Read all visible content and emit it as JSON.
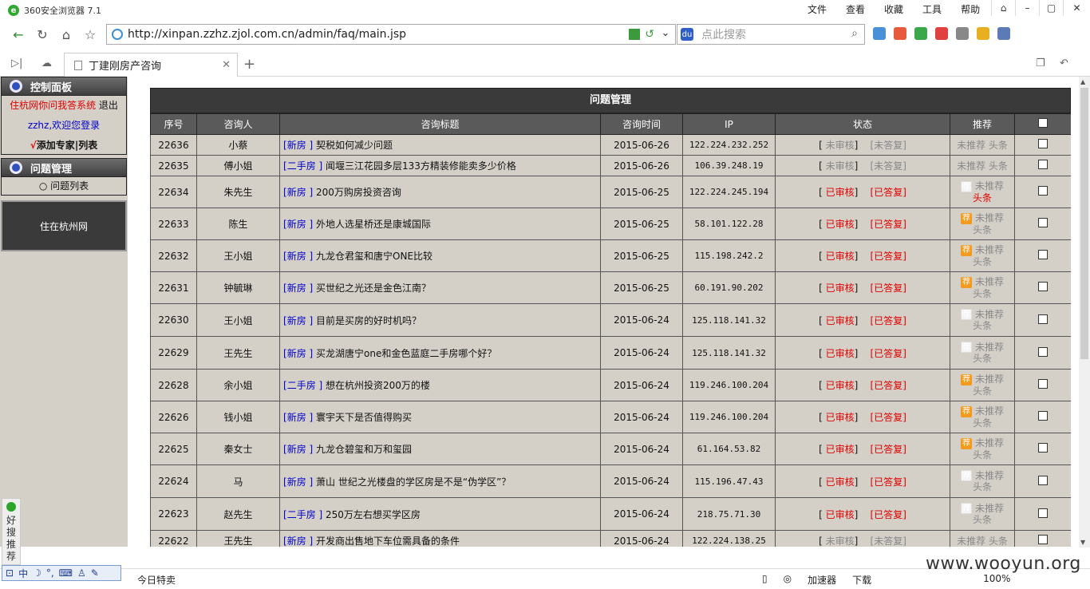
{
  "browser": {
    "window_title": "360安全浏览器 7.1",
    "menus": [
      "文件",
      "查看",
      "收藏",
      "工具",
      "帮助"
    ],
    "url": "http://xinpan.zzhz.zjol.com.cn/admin/faq/main.jsp",
    "search_placeholder": "点此搜索",
    "tab_title": "丁建刚房产咨询",
    "status_today": "今日特卖",
    "status_items": [
      "加速器",
      "下载",
      "100%"
    ],
    "watermark": "www.wooyun.org",
    "side_float": "好搜推荐"
  },
  "left_panel": {
    "control_header": "控制面板",
    "system_name": "住杭网你问我答系统",
    "logout": "退出",
    "welcome": "zzhz,欢迎您登录",
    "add_expert": "添加专家",
    "list": "列表",
    "check_mark": "√",
    "question_header": "问题管理",
    "question_list": "问题列表",
    "site_name": "住在杭州网"
  },
  "table": {
    "title": "问题管理",
    "headers": [
      "序号",
      "咨询人",
      "咨询标题",
      "咨询时间",
      "IP",
      "状态",
      "推荐"
    ],
    "rows": [
      {
        "id": "22636",
        "person": "小蔡",
        "cat": "新房",
        "title": "契税如何减少问题",
        "date": "2015-06-26",
        "ip": "122.224.232.252",
        "audit": "未审核",
        "answer": "未答复",
        "reviewed": false,
        "rec": "未推荐",
        "head": "头条",
        "icon": "none"
      },
      {
        "id": "22635",
        "person": "傅小姐",
        "cat": "二手房",
        "title": "闻堰三江花园多层133方精装修能卖多少价格",
        "date": "2015-06-26",
        "ip": "106.39.248.19",
        "audit": "未审核",
        "answer": "未答复",
        "reviewed": false,
        "rec": "未推荐",
        "head": "头条",
        "icon": "none"
      },
      {
        "id": "22634",
        "person": "朱先生",
        "cat": "新房",
        "title": "200万购房投资咨询",
        "date": "2015-06-25",
        "ip": "122.224.245.194",
        "audit": "已审核",
        "answer": "已答复",
        "reviewed": true,
        "rec": "未推荐",
        "head": "头条",
        "icon": "off",
        "head_red": true
      },
      {
        "id": "22633",
        "person": "陈生",
        "cat": "新房",
        "title": "外地人选星桥还是康城国际",
        "date": "2015-06-25",
        "ip": "58.101.122.28",
        "audit": "已审核",
        "answer": "已答复",
        "reviewed": true,
        "rec": "未推荐",
        "head": "头条",
        "icon": "on"
      },
      {
        "id": "22632",
        "person": "王小姐",
        "cat": "新房",
        "title": "九龙仓君玺和唐宁ONE比较",
        "date": "2015-06-25",
        "ip": "115.198.242.2",
        "audit": "已审核",
        "answer": "已答复",
        "reviewed": true,
        "rec": "未推荐",
        "head": "头条",
        "icon": "on"
      },
      {
        "id": "22631",
        "person": "钟毓琳",
        "cat": "新房",
        "title": "买世纪之光还是金色江南？",
        "date": "2015-06-25",
        "ip": "60.191.90.202",
        "audit": "已审核",
        "answer": "已答复",
        "reviewed": true,
        "rec": "未推荐",
        "head": "头条",
        "icon": "on"
      },
      {
        "id": "22630",
        "person": "王小姐",
        "cat": "新房",
        "title": "目前是买房的好时机吗？",
        "date": "2015-06-24",
        "ip": "125.118.141.32",
        "audit": "已审核",
        "answer": "已答复",
        "reviewed": true,
        "rec": "未推荐",
        "head": "头条",
        "icon": "off"
      },
      {
        "id": "22629",
        "person": "王先生",
        "cat": "新房",
        "title": "买龙湖唐宁one和金色蓝庭二手房哪个好？",
        "date": "2015-06-24",
        "ip": "125.118.141.32",
        "audit": "已审核",
        "answer": "已答复",
        "reviewed": true,
        "rec": "未推荐",
        "head": "头条",
        "icon": "off"
      },
      {
        "id": "22628",
        "person": "余小姐",
        "cat": "二手房",
        "title": "想在杭州投资200万的楼",
        "date": "2015-06-24",
        "ip": "119.246.100.204",
        "audit": "已审核",
        "answer": "已答复",
        "reviewed": true,
        "rec": "未推荐",
        "head": "头条",
        "icon": "on"
      },
      {
        "id": "22626",
        "person": "钱小姐",
        "cat": "新房",
        "title": "寰宇天下是否值得购买",
        "date": "2015-06-24",
        "ip": "119.246.100.204",
        "audit": "已审核",
        "answer": "已答复",
        "reviewed": true,
        "rec": "未推荐",
        "head": "头条",
        "icon": "on"
      },
      {
        "id": "22625",
        "person": "秦女士",
        "cat": "新房",
        "title": "九龙仓碧玺和万和玺园",
        "date": "2015-06-24",
        "ip": "61.164.53.82",
        "audit": "已审核",
        "answer": "已答复",
        "reviewed": true,
        "rec": "未推荐",
        "head": "头条",
        "icon": "on"
      },
      {
        "id": "22624",
        "person": "马",
        "cat": "新房",
        "title": "萧山 世纪之光楼盘的学区房是不是“伪学区”？",
        "date": "2015-06-24",
        "ip": "115.196.47.43",
        "audit": "已审核",
        "answer": "已答复",
        "reviewed": true,
        "rec": "未推荐",
        "head": "头条",
        "icon": "off"
      },
      {
        "id": "22623",
        "person": "赵先生",
        "cat": "二手房",
        "title": "250万左右想买学区房",
        "date": "2015-06-24",
        "ip": "218.75.71.30",
        "audit": "已审核",
        "answer": "已答复",
        "reviewed": true,
        "rec": "未推荐",
        "head": "头条",
        "icon": "off"
      },
      {
        "id": "22622",
        "person": "王先生",
        "cat": "新房",
        "title": "开发商出售地下车位需具备的条件",
        "date": "2015-06-24",
        "ip": "122.224.138.25",
        "audit": "未审核",
        "answer": "未答复",
        "reviewed": false,
        "rec": "未推荐",
        "head": "头条",
        "icon": "none"
      }
    ]
  },
  "tj_label": "荐"
}
